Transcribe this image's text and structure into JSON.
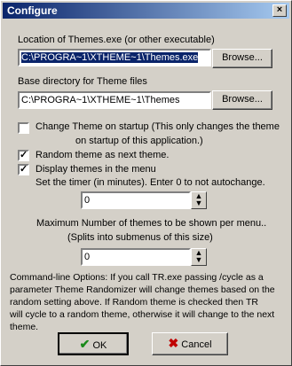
{
  "window": {
    "title": "Configure",
    "close_glyph": "×"
  },
  "themes_exe": {
    "label": "Location of Themes.exe (or other executable)",
    "value": "C:\\PROGRA~1\\XTHEME~1\\Themes.exe",
    "browse": "Browse..."
  },
  "base_dir": {
    "label": "Base directory for Theme files",
    "value": "C:\\PROGRA~1\\XTHEME~1\\Themes",
    "browse": "Browse..."
  },
  "options": {
    "change_on_startup": {
      "checked": false,
      "label_line1": "Change Theme on startup (This only changes the theme",
      "label_line2": "on startup of this application.)"
    },
    "random_next": {
      "checked": true,
      "label": "Random theme as next theme."
    },
    "display_menu": {
      "checked": true,
      "label": "Display themes in the menu"
    }
  },
  "timer": {
    "label": "Set the timer (in minutes). Enter 0 to not autochange.",
    "value": "0"
  },
  "max_themes": {
    "label_line1": "Maximum Number of themes to be shown per menu..",
    "label_line2": "(Splits into submenus of this size)",
    "value": "0"
  },
  "command_line": {
    "line1": "Command-line Options:  If you call TR.exe passing /cycle as a",
    "line2": "parameter Theme Randomizer will change themes based on the",
    "line3": "random setting above.  If Random theme is checked then TR",
    "line4": "will cycle to a random theme, otherwise it will change to the next",
    "line5": "theme."
  },
  "buttons": {
    "ok": "OK",
    "cancel": "Cancel"
  },
  "colors": {
    "title_start": "#0a246a",
    "title_end": "#a6caf0",
    "ok_icon": "#1a8a1a",
    "cancel_icon": "#c00000"
  }
}
